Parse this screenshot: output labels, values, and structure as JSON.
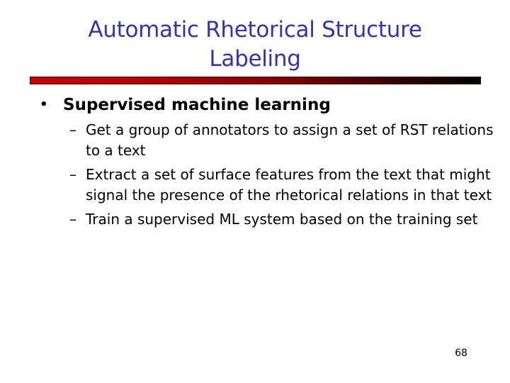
{
  "slide": {
    "title": {
      "line1": "Automatic Rhetorical Structure",
      "line2": "Labeling"
    },
    "colors": {
      "title": "#3333b3",
      "bar_start": "#cc0000",
      "bar_end": "#000000",
      "body_text": "#000000"
    },
    "bullets": [
      {
        "marker": "•",
        "text": "Supervised machine learning",
        "sub_items": [
          {
            "marker": "–",
            "text": "Get a group of annotators to assign a set of RST relations to a text"
          },
          {
            "marker": "–",
            "text": "Extract a set of surface features from the text that might signal the presence of the rhetorical relations in that text"
          },
          {
            "marker": "–",
            "text": "Train a supervised ML system based on the training set"
          }
        ]
      }
    ],
    "page_number": "68"
  }
}
